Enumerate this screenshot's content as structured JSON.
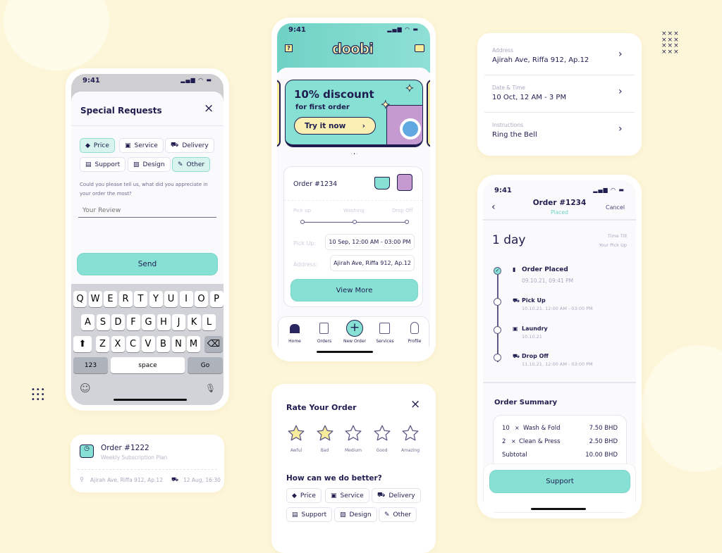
{
  "colors": {
    "background": "#fdf6d9",
    "accent": "#86e0d4",
    "text": "#1f1d4f",
    "muted": "#a9a8c0",
    "star": "#f7ec9c"
  },
  "special_requests": {
    "time": "9:41",
    "title": "Special Requests",
    "close_icon": "close-icon",
    "chips": [
      {
        "label": "Price",
        "icon": "tag-icon",
        "selected": true
      },
      {
        "label": "Service",
        "icon": "service-icon",
        "selected": false
      },
      {
        "label": "Delivery",
        "icon": "truck-icon",
        "selected": false
      },
      {
        "label": "Support",
        "icon": "chat-icon",
        "selected": false
      },
      {
        "label": "Design",
        "icon": "image-icon",
        "selected": false
      },
      {
        "label": "Other",
        "icon": "pencil-icon",
        "selected": true
      }
    ],
    "question": "Could you please tell us, what did you appreciate in your order the most?",
    "review_placeholder": "Your Review",
    "send": "Send",
    "keyboard": {
      "row1": [
        "Q",
        "W",
        "E",
        "R",
        "T",
        "Y",
        "U",
        "I",
        "O",
        "P"
      ],
      "row2": [
        "A",
        "S",
        "D",
        "F",
        "G",
        "H",
        "J",
        "K",
        "L"
      ],
      "row3": [
        "Z",
        "X",
        "C",
        "V",
        "B",
        "N",
        "M"
      ],
      "num": "123",
      "space": "space",
      "go": "Go"
    }
  },
  "order_card": {
    "title": "Order #1222",
    "subtitle": "Weekly Subscription Plan",
    "address": "Ajirah Ave, Riffa 912, Ap.12",
    "time": "12 Aug, 16:30"
  },
  "home": {
    "time": "9:41",
    "logo": "doobi",
    "banner": {
      "title": "10% discount",
      "subtitle": "for first order",
      "cta": "Try it now"
    },
    "order": {
      "title": "Order #1234",
      "steps": [
        "Pick up",
        "Washing",
        "Drop Off"
      ],
      "pickup_label": "Pick Up:",
      "pickup_value": "10 Sep, 12:00 AM - 03:00 PM",
      "address_label": "Address:",
      "address_value": "Ajirah Ave, Riffa 912, Ap.12",
      "view_more": "View More"
    },
    "nav": [
      {
        "label": "Home",
        "icon": "home-icon",
        "active": true
      },
      {
        "label": "Orders",
        "icon": "receipt-icon"
      },
      {
        "label": "New Order",
        "icon": "plus-icon"
      },
      {
        "label": "Services",
        "icon": "washer-icon"
      },
      {
        "label": "Profile",
        "icon": "profile-icon"
      }
    ]
  },
  "rate": {
    "title": "Rate Your Order",
    "rating": 2,
    "max": 5,
    "labels": [
      "Awful",
      "Bad",
      "Medium",
      "Good",
      "Amazing"
    ],
    "better": "How can we do better?",
    "chips": [
      "Price",
      "Service",
      "Delivery",
      "Support",
      "Design",
      "Other"
    ]
  },
  "details": {
    "rows": [
      {
        "label": "Address",
        "value": "Ajirah Ave, Riffa 912, Ap.12"
      },
      {
        "label": "Date & Time",
        "value": "10 Oct, 12 AM - 3 PM"
      },
      {
        "label": "Instructions",
        "value": "Ring the Bell"
      }
    ]
  },
  "tracking": {
    "time": "9:41",
    "title": "Order #1234",
    "status": "Placed",
    "cancel": "Cancel",
    "eta": "1 day",
    "eta_label1": "Time Till",
    "eta_label2": "Your Pick Up",
    "steps": [
      {
        "name": "Order Placed",
        "time": "09.10.21, 09:41 PM",
        "done": true
      },
      {
        "name": "Pick Up",
        "time": "10.10.21, 12:00 AM - 03:00 PM"
      },
      {
        "name": "Laundry",
        "time": "10.10.21"
      },
      {
        "name": "Drop Off",
        "time": "11.10.21, 12:00 AM - 03:00 PM"
      }
    ],
    "summary_title": "Order Summary",
    "items": [
      {
        "qty": "10",
        "x": "×",
        "name": "Wash & Fold",
        "price": "7.50 BHD"
      },
      {
        "qty": "2",
        "x": "×",
        "name": "Clean & Press",
        "price": "2.50 BHD"
      }
    ],
    "subtotal_label": "Subtotal",
    "subtotal": "10.00 BHD",
    "support": "Support"
  }
}
